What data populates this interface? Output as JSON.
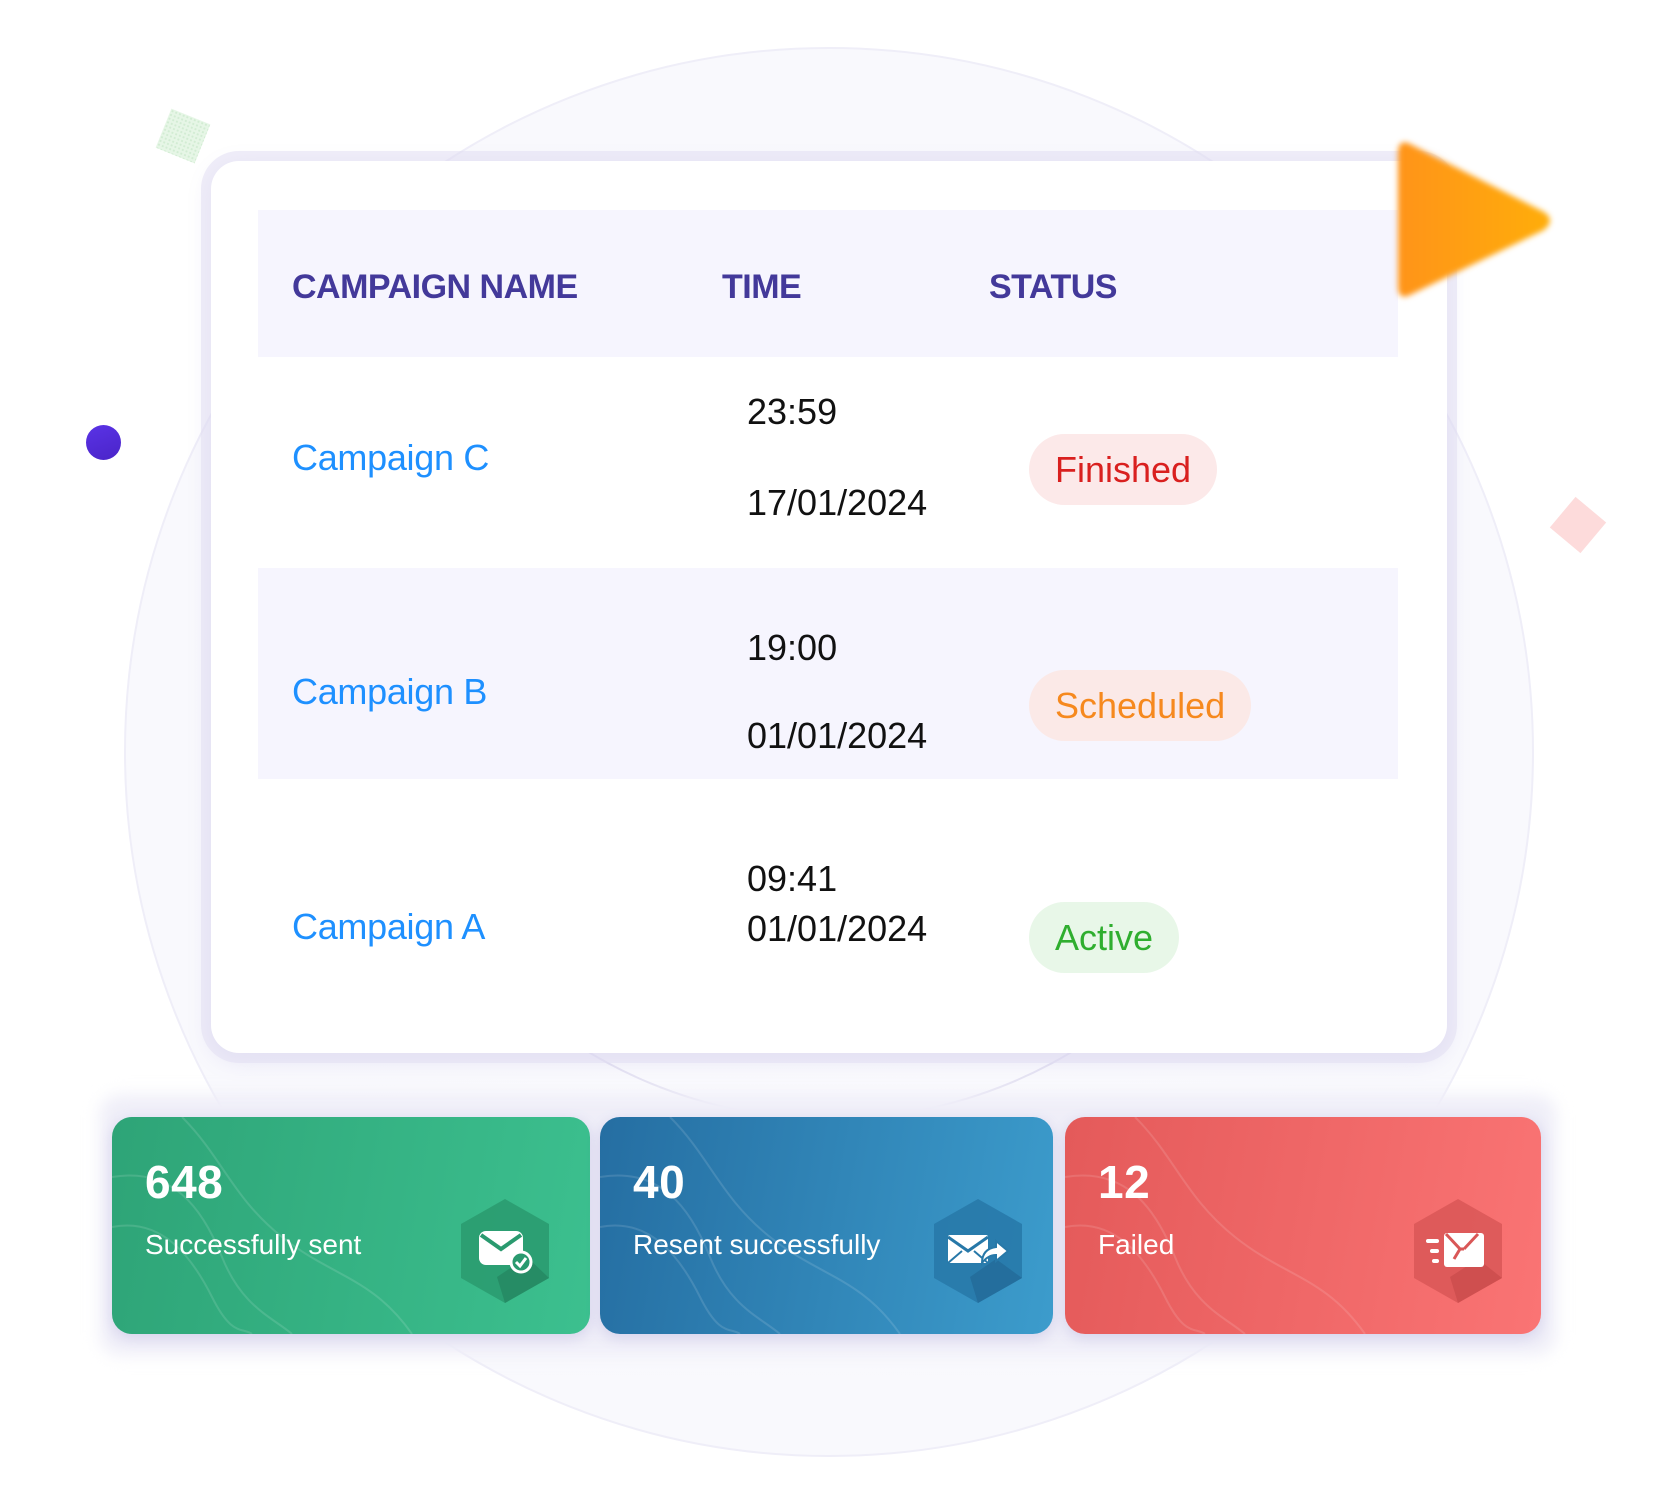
{
  "table": {
    "headers": {
      "name": "CAMPAIGN NAME",
      "time": "TIME",
      "status": "STATUS"
    },
    "rows": [
      {
        "name": "Campaign C",
        "time": "23:59",
        "date": "17/01/2024",
        "status": "Finished",
        "status_color": "#d9201f"
      },
      {
        "name": "Campaign B",
        "time": "19:00",
        "date": "01/01/2024",
        "status": "Scheduled",
        "status_color": "#f6891e"
      },
      {
        "name": "Campaign A",
        "time": "09:41",
        "date": "01/01/2024",
        "status": "Active",
        "status_color": "#2fae2f"
      }
    ]
  },
  "stats": [
    {
      "value": "648",
      "label": "Successfully sent",
      "icon": "mail-check-icon",
      "color": "#35b383"
    },
    {
      "value": "40",
      "label": "Resent successfully",
      "icon": "mail-forward-icon",
      "color": "#2f85b7"
    },
    {
      "value": "12",
      "label": "Failed",
      "icon": "mail-broken-icon",
      "color": "#ef6767"
    }
  ],
  "colors": {
    "header_text": "#43399a",
    "link": "#1e90ff",
    "accent_orange": "#ff9f1a",
    "accent_purple": "#5230d8"
  }
}
